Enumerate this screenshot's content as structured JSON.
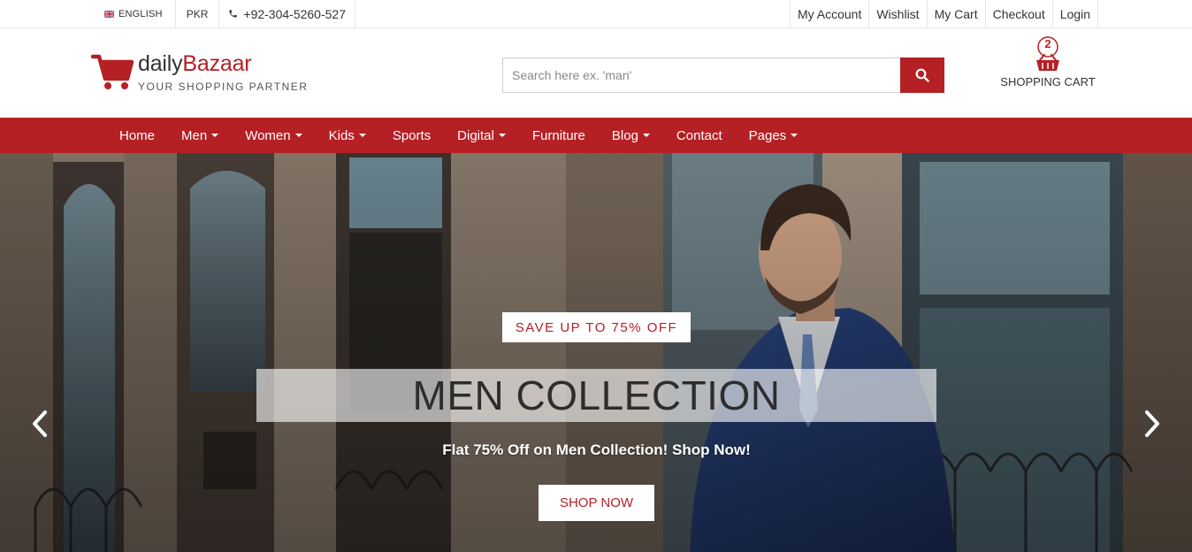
{
  "topbar": {
    "language": "ENGLISH",
    "currency": "PKR",
    "phone": "+92-304-5260-527",
    "links": [
      "My Account",
      "Wishlist",
      "My Cart",
      "Checkout",
      "Login"
    ]
  },
  "logo": {
    "name_part1": "daily",
    "name_part2": "Bazaar",
    "tagline": "YOUR SHOPPING PARTNER"
  },
  "search": {
    "placeholder": "Search here ex. 'man'",
    "value": ""
  },
  "cart": {
    "count": "2",
    "label": "SHOPPING CART"
  },
  "nav": {
    "items": [
      {
        "label": "Home"
      },
      {
        "label": "Men"
      },
      {
        "label": "Women"
      },
      {
        "label": "Kids"
      },
      {
        "label": "Sports"
      },
      {
        "label": "Digital"
      },
      {
        "label": "Furniture"
      },
      {
        "label": "Blog"
      },
      {
        "label": "Contact"
      },
      {
        "label": "Pages"
      }
    ]
  },
  "hero": {
    "badge": "SAVE UP TO 75% OFF",
    "title": "MEN COLLECTION",
    "subtitle": "Flat 75% Off on Men Collection! Shop Now!",
    "button": "SHOP NOW"
  },
  "colors": {
    "accent": "#b52025",
    "text": "#333333",
    "border": "#e6e6e6"
  },
  "icons": [
    "uk-flag-icon",
    "phone-icon",
    "cart-logo-icon",
    "search-icon",
    "basket-icon",
    "chevron-left-icon",
    "chevron-right-icon"
  ]
}
